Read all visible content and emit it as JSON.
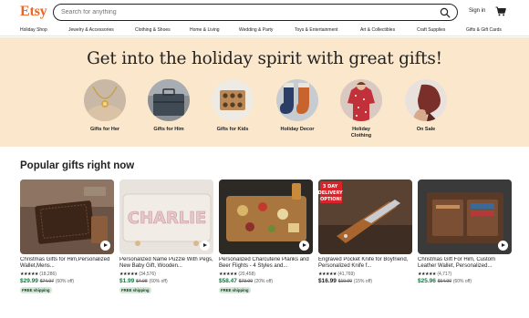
{
  "header": {
    "logo": "Etsy",
    "search_placeholder": "Search for anything",
    "signin_label": "Sign in"
  },
  "categories": [
    "Holiday Shop",
    "Jewelry & Accessories",
    "Clothing & Shoes",
    "Home & Living",
    "Wedding & Party",
    "Toys & Entertainment",
    "Art & Collectibles",
    "Craft Supplies",
    "Gifts & Gift Cards"
  ],
  "hero": {
    "title": "Get into the holiday spirit with great gifts!",
    "circles": [
      {
        "label": "Gifts for Her"
      },
      {
        "label": "Gifts for Him"
      },
      {
        "label": "Gifts for Kids"
      },
      {
        "label": "Holiday Decor"
      },
      {
        "label": "Holiday\nClothing"
      },
      {
        "label": "On Sale"
      }
    ]
  },
  "popular": {
    "title": "Popular gifts right now",
    "products": [
      {
        "title": "Christmas Gifts for Him,Personalized Wallet,Mens...",
        "stars": "★★★★★",
        "reviews": "(18,286)",
        "price": "$29.99",
        "original": "$74.97",
        "discount": "(60% off)",
        "shipping": "FREE shipping"
      },
      {
        "title": "Personalized Name Puzzle With Pegs, New Baby Gift, Wooden...",
        "stars": "★★★★★",
        "reviews": "(34,576)",
        "price": "$1.99",
        "original": "$4.98",
        "discount": "(60% off)",
        "shipping": "FREE shipping"
      },
      {
        "title": "Personalized Charcuterie Planks and Beer Flights - 4 Styles and...",
        "stars": "★★★★★",
        "reviews": "(20,458)",
        "price": "$58.47",
        "original": "$73.09",
        "discount": "(20% off)",
        "shipping": "FREE shipping"
      },
      {
        "title": "Engraved Pocket Knife for Boyfriend, Personalized Knife f...",
        "stars": "★★★★★",
        "reviews": "(41,769)",
        "price": "$16.99",
        "original": "$19.99",
        "discount": "(15% off)",
        "shipping": ""
      },
      {
        "title": "Christmas Gift For Him, Custom Leather Wallet, Personalized...",
        "stars": "★★★★★",
        "reviews": "(4,717)",
        "price": "$25.96",
        "original": "$64.90",
        "discount": "(60% off)",
        "shipping": ""
      }
    ],
    "knife_badge": "3 DAY\nDELIVERY\nOPTION!",
    "puzzle_name": "CHARLIE"
  },
  "colors": {
    "brand": "#f1641e",
    "hero_bg": "#fbe7cc",
    "price_green": "#0e7a3a",
    "shipping_bg": "#d4e9d7"
  }
}
